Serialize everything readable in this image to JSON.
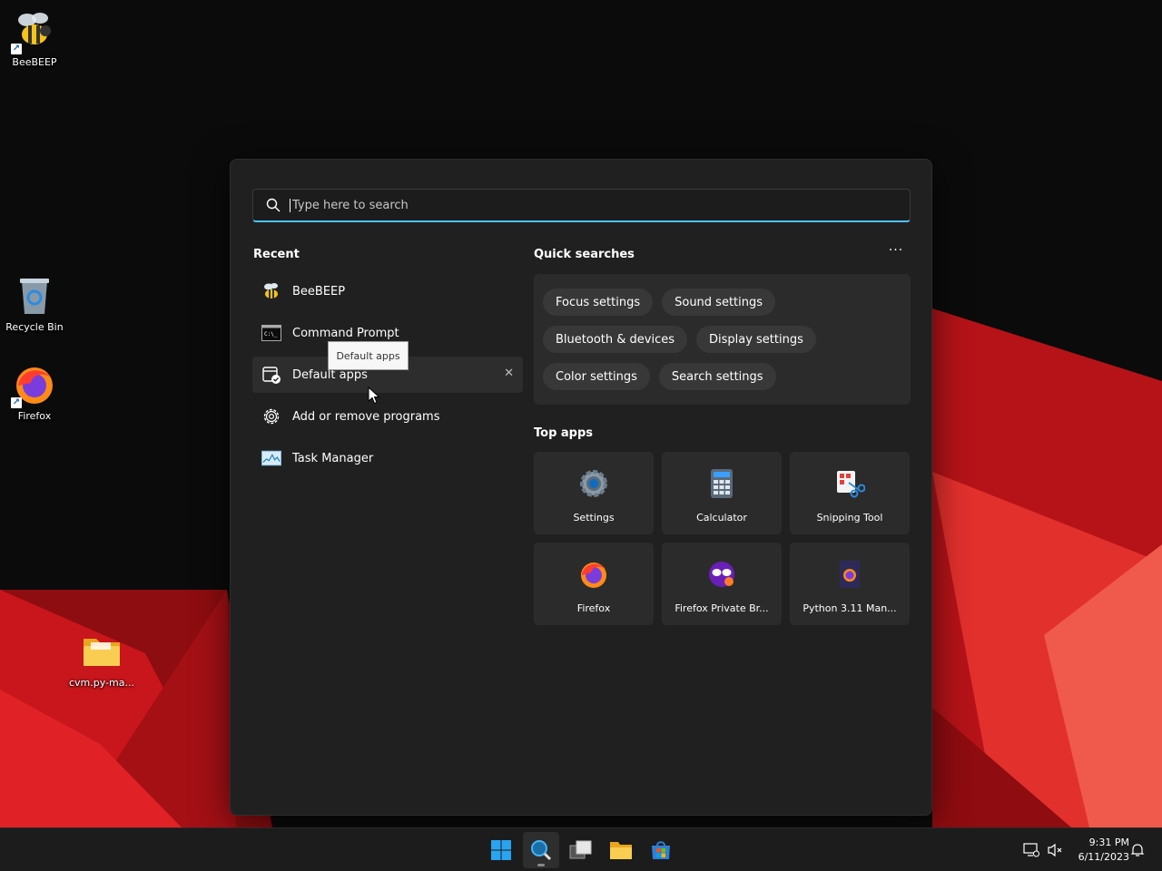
{
  "desktop": {
    "icons": [
      {
        "label": "BeeBEEP"
      },
      {
        "label": "Recycle Bin"
      },
      {
        "label": "Firefox"
      },
      {
        "label": "cvm.py-ma..."
      }
    ]
  },
  "search": {
    "placeholder": "Type here to search"
  },
  "recent": {
    "title": "Recent",
    "items": [
      {
        "label": "BeeBEEP",
        "icon": "beebeep-icon"
      },
      {
        "label": "Command Prompt",
        "icon": "command-prompt-icon"
      },
      {
        "label": "Default apps",
        "icon": "default-apps-icon"
      },
      {
        "label": "Add or remove programs",
        "icon": "gear-icon"
      },
      {
        "label": "Task Manager",
        "icon": "task-manager-icon"
      }
    ],
    "tooltip": "Default apps",
    "remove_glyph": "✕"
  },
  "quick_searches": {
    "title": "Quick searches",
    "more_glyph": "···",
    "rows": [
      [
        "Focus settings",
        "Sound settings"
      ],
      [
        "Bluetooth & devices",
        "Display settings"
      ],
      [
        "Color settings",
        "Search settings"
      ]
    ]
  },
  "top_apps": {
    "title": "Top apps",
    "items": [
      {
        "label": "Settings",
        "icon": "settings-icon"
      },
      {
        "label": "Calculator",
        "icon": "calculator-icon"
      },
      {
        "label": "Snipping Tool",
        "icon": "snipping-tool-icon"
      },
      {
        "label": "Firefox",
        "icon": "firefox-icon"
      },
      {
        "label": "Firefox Private Br...",
        "icon": "firefox-private-icon"
      },
      {
        "label": "Python 3.11 Man...",
        "icon": "python-manual-icon"
      }
    ]
  },
  "taskbar": {
    "time": "9:31 PM",
    "date": "6/11/2023"
  },
  "colors": {
    "accent": "#4cc2ff",
    "panel_bg": "#202020",
    "wallpaper_red": "#c8161c"
  }
}
